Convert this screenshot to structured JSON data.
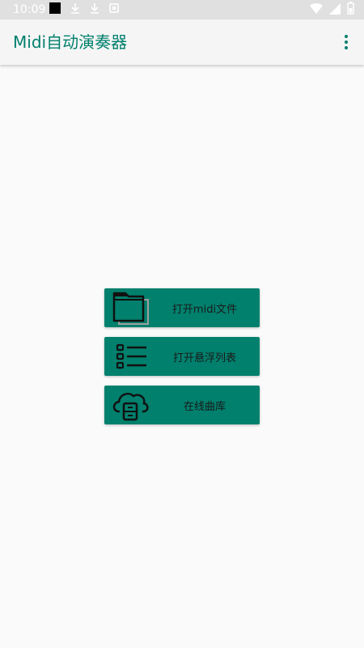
{
  "status_bar": {
    "time": "10:09",
    "icons": [
      "notification-square-icon",
      "download-icon",
      "download-icon",
      "notification-badge-icon",
      "wifi-icon",
      "cell-signal-icon",
      "battery-icon"
    ]
  },
  "app_bar": {
    "title": "Midi自动演奏器",
    "overflow_icon": "more-vert-icon"
  },
  "buttons": [
    {
      "label": "打开midi文件",
      "icon": "folder-icon"
    },
    {
      "label": "打开悬浮列表",
      "icon": "list-icon"
    },
    {
      "label": "在线曲库",
      "icon": "cloud-storage-icon"
    }
  ],
  "colors": {
    "accent": "#00806d",
    "background": "#fafafa",
    "app_bar": "#f5f5f5",
    "status_bar": "#e0e0e0"
  }
}
